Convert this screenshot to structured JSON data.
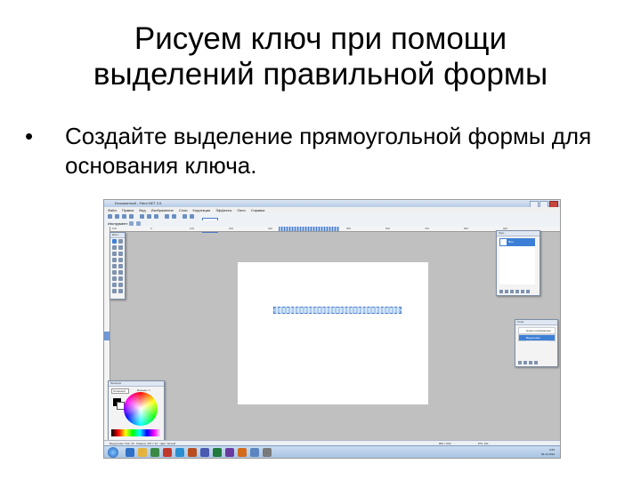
{
  "slide": {
    "title_line1": "Рисуем ключ при помощи",
    "title_line2": "выделений правильной формы",
    "bullet_marker": "•",
    "bullet_text": "Создайте выделение прямоугольной формы для основания ключа."
  },
  "app": {
    "window_title": "Безымянный - Paint.NET 3.5",
    "menu": [
      "Файл",
      "Правка",
      "Вид",
      "Изображение",
      "Слои",
      "Коррекция",
      "Эффекты",
      "Окно",
      "Справка"
    ],
    "toolbar_tool_label": "Инструмент:",
    "ruler_ticks": [
      "-100",
      "0",
      "100",
      "200",
      "300",
      "400",
      "500",
      "600",
      "700",
      "800",
      "900"
    ],
    "panels": {
      "tools_title": "Инст...",
      "history_title": "Жур...",
      "history_item": "Фон",
      "layers_title": "Слои",
      "layers_rows": [
        "Новое изображение",
        "Выделение прямоугольником"
      ],
      "palette_title": "Палитра",
      "palette_mode": "Основной",
      "palette_more": "Больше >>"
    },
    "status": {
      "left": "Выделение: 512, 16 · Размер: 207 × 10 · Цвет: Белый",
      "size": "800 × 600",
      "coords": "875, 101"
    },
    "clock": {
      "time": "9:59",
      "date": "06.12.2010"
    }
  }
}
